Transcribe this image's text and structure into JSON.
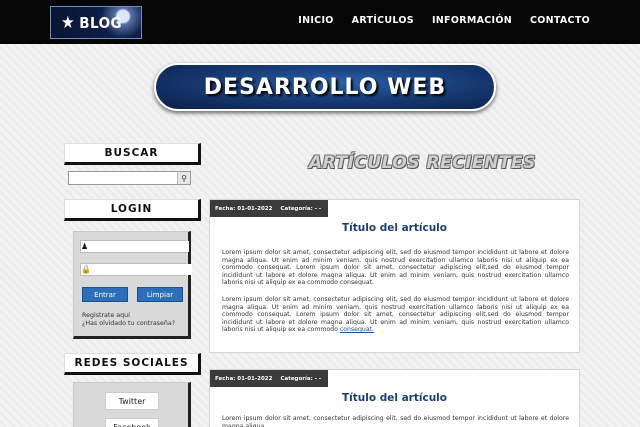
{
  "header": {
    "logo_text": "BLOG",
    "logo_icon": "star-icon",
    "nav": [
      "INICIO",
      "ARTÍCULOS",
      "INFORMACIÓN",
      "CONTACTO"
    ]
  },
  "hero": {
    "title": "DESARROLLO WEB"
  },
  "sidebar": {
    "search_title": "BUSCAR",
    "search_placeholder": "",
    "login_title": "LOGIN",
    "login_buttons": {
      "enter": "Entrar",
      "clear": "Limpiar"
    },
    "login_links": {
      "register": "Registrate aquí",
      "forgot": "¿Has olvidado tu contraseña?"
    },
    "social_title": "REDES SOCIALES",
    "social_buttons": [
      "Twitter",
      "Facebook"
    ]
  },
  "main": {
    "section_title": "ARTÍCULOS RECIENTES",
    "articles": [
      {
        "date": "Fecha: 01-01-2022",
        "category": "Categoría: - -",
        "title": "Título del artículo",
        "paragraph1": "Lorem ipsum dolor sit amet, consectetur adipiscing elit, sed do eiusmod tempor incididunt ut labore et dolore magna aliqua. Ut enim ad minim veniam, quis nostrud exercitation ullamco laboris nisi ut aliquip ex ea commodo consequat. Lorem ipsum dolor sit amet, consectetur adipiscing elit,sed do eiusmod tempor incididunt ut labore et dolore magna aliqua. Ut enim ad minim veniam, quis nostrud exercitation ullamco laboris nisi ut aliquip ex ea commodo consequat.",
        "paragraph2": "Lorem ipsum dolor sit amet, consectetur adipiscing elit, sed do eiusmod tempor incididunt ut labore et dolore magna aliqua. Ut enim ad minim veniam, quis nostrud exercitation ullamco laboris nisi ut aliquip ex ea commodo consequat. Lorem ipsum dolor sit amet, consectetur adipiscing elit,sed do eiusmod tempor incididunt ut labore et dolore magna aliqua. Ut enim ad minim veniam, quis nostrud exercitation ullamco laboris nisi ut aliquip ex ea commodo",
        "link": "consequat."
      },
      {
        "date": "Fecha: 01-01-2022",
        "category": "Categoría: - -",
        "title": "Título del artículo",
        "paragraph1": "Lorem ipsum dolor sit amet, consectetur adipiscing elit, sed do eiusmod tempor incididunt ut labore et dolore magna aliqua."
      }
    ]
  }
}
